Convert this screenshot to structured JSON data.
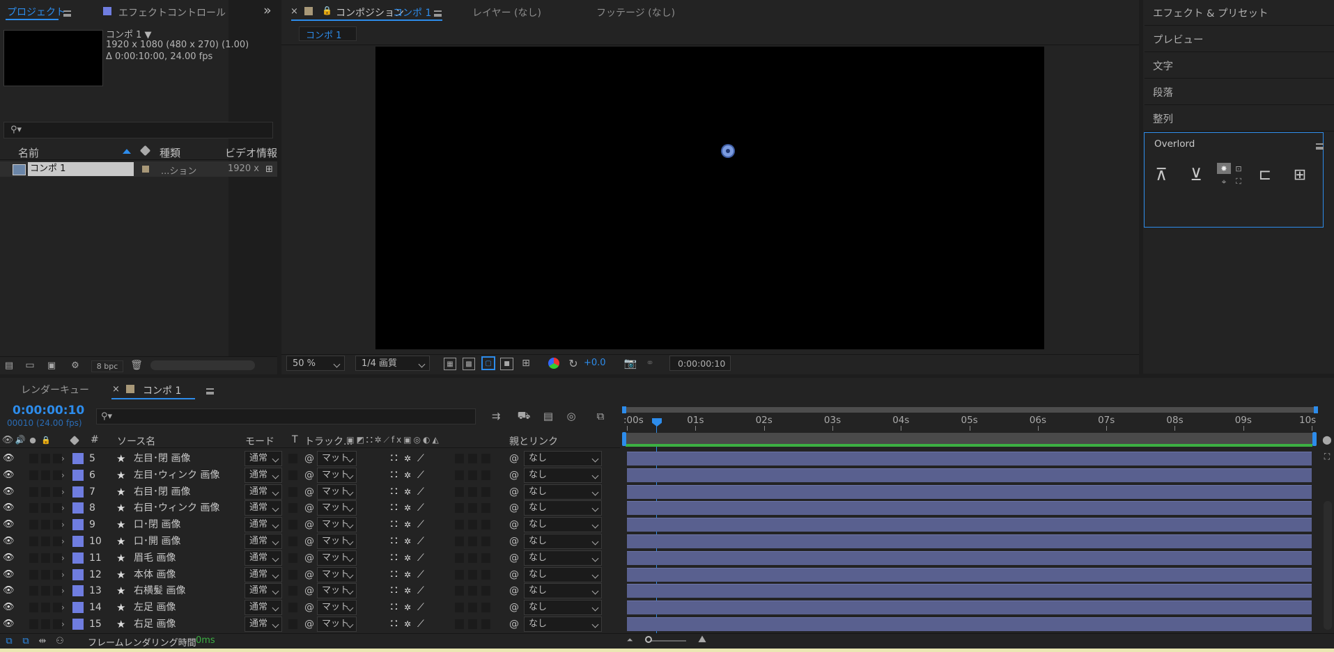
{
  "project_panel": {
    "tab_label": "プロジェクト",
    "effect_tab_label": "エフェクトコントロール 左たまね",
    "comp_info": {
      "name": "コンポ 1 ▼",
      "size_line": "1920 x 1080  (480 x 270) (1.00)",
      "duration_line": "Δ 0:00:10:00, 24.00 fps"
    },
    "columns": {
      "name": "名前",
      "type": "種類",
      "video_info": "ビデオ情報"
    },
    "items": [
      {
        "name": "コンポ 1",
        "type": "...ション",
        "video": "1920 x"
      }
    ],
    "bpc": "8 bpc"
  },
  "comp_panel": {
    "close": "×",
    "tab_prefix": "コンポジション",
    "tab_comp": "コンポ 1",
    "layer_tab": "レイヤー (なし)",
    "footage_tab": "フッテージ (なし)",
    "breadcrumb": "コンポ 1",
    "zoom": "50 %",
    "quality": "1/4 画質",
    "exposure": "+0.0",
    "timecode": "0:00:00:10"
  },
  "right_panel": {
    "items": [
      "エフェクト & プリセット",
      "プレビュー",
      "文字",
      "段落",
      "整列"
    ],
    "overlord_title": "Overlord"
  },
  "timeline": {
    "render_queue_tab": "レンダーキュー",
    "comp_tab": "コンポ 1",
    "close": "×",
    "current_time": "0:00:00:10",
    "frame_info": "00010 (24.00 fps)",
    "column_headers": {
      "source_name": "ソース名",
      "mode": "モード",
      "t": "T",
      "track": "トラック...",
      "parent": "親とリンク",
      "num": "#"
    },
    "ruler": [
      ":00s",
      "01s",
      "02s",
      "03s",
      "04s",
      "05s",
      "06s",
      "07s",
      "08s",
      "09s",
      "10s"
    ],
    "layers": [
      {
        "num": "5",
        "name": "左目･閉 画像",
        "mode": "通常",
        "track": "マット",
        "parent": "なし"
      },
      {
        "num": "6",
        "name": "左目･ウィンク 画像",
        "mode": "通常",
        "track": "マット",
        "parent": "なし"
      },
      {
        "num": "7",
        "name": "右目･閉 画像",
        "mode": "通常",
        "track": "マット",
        "parent": "なし"
      },
      {
        "num": "8",
        "name": "右目･ウィンク 画像",
        "mode": "通常",
        "track": "マット",
        "parent": "なし"
      },
      {
        "num": "9",
        "name": "口･閉 画像",
        "mode": "通常",
        "track": "マット",
        "parent": "なし"
      },
      {
        "num": "10",
        "name": "口･開 画像",
        "mode": "通常",
        "track": "マット",
        "parent": "なし"
      },
      {
        "num": "11",
        "name": "眉毛 画像",
        "mode": "通常",
        "track": "マット",
        "parent": "なし"
      },
      {
        "num": "12",
        "name": "本体 画像",
        "mode": "通常",
        "track": "マット",
        "parent": "なし"
      },
      {
        "num": "13",
        "name": "右横髪 画像",
        "mode": "通常",
        "track": "マット",
        "parent": "なし"
      },
      {
        "num": "14",
        "name": "左足 画像",
        "mode": "通常",
        "track": "マット",
        "parent": "なし"
      },
      {
        "num": "15",
        "name": "右足 画像",
        "mode": "通常",
        "track": "マット",
        "parent": "なし"
      }
    ],
    "footer_label": "フレームレンダリング時間",
    "footer_value": "0ms"
  },
  "colors": {
    "accent": "#2d8ceb",
    "label_swatch": "#6f7de0",
    "layer_bar": "#59608f",
    "work_area_green": "#3cb043",
    "bottom_strip": "#eae7b2"
  }
}
